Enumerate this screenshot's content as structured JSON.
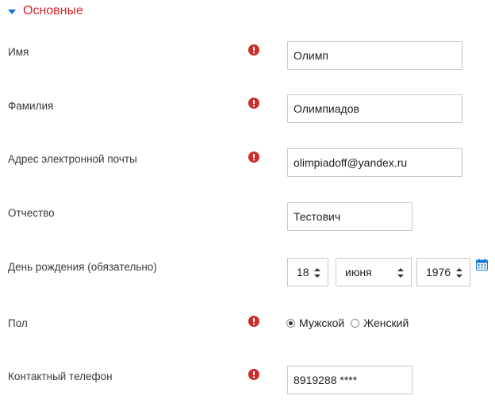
{
  "section": {
    "title": "Основные"
  },
  "fields": {
    "first_name": {
      "label": "Имя",
      "value": "Олимп",
      "required": true
    },
    "last_name": {
      "label": "Фамилия",
      "value": "Олимпиадов",
      "required": true
    },
    "email": {
      "label": "Адрес электронной почты",
      "value": "olimpiadoff@yandex.ru",
      "required": true
    },
    "middle_name": {
      "label": "Отчество",
      "value": "Тестович",
      "required": false
    },
    "birthday": {
      "label": "День рождения (обязательно)",
      "day": "18",
      "month": "июня",
      "year": "1976"
    },
    "gender": {
      "label": "Пол",
      "options": [
        "Мужской",
        "Женский"
      ],
      "selected": "Мужской",
      "required": true
    },
    "phone": {
      "label": "Контактный телефон",
      "value": "8919288 ****",
      "required": true
    }
  },
  "colors": {
    "section_title": "#d9222a",
    "caret": "#1177d1",
    "required_icon": "#c9302c",
    "calendar_icon": "#1177d1"
  }
}
